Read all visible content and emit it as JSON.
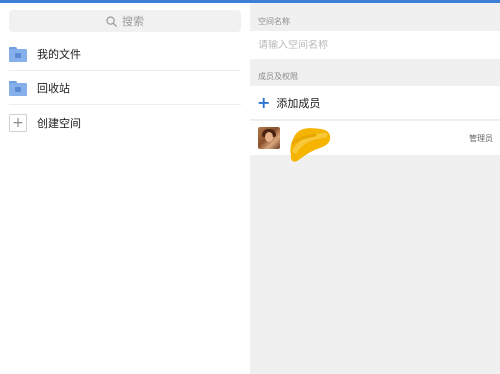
{
  "left": {
    "search": {
      "placeholder": "搜索"
    },
    "items": [
      {
        "label": "我的文件",
        "icon": "folder-icon"
      },
      {
        "label": "回收站",
        "icon": "folder-icon"
      },
      {
        "label": "创建空间",
        "icon": "plus-icon"
      }
    ]
  },
  "right": {
    "space_name_label": "空间名称",
    "space_name_placeholder": "请输入空间名称",
    "members_label": "成员及权限",
    "add_member_label": "添加成员",
    "members": [
      {
        "role": "管理员"
      }
    ]
  },
  "colors": {
    "accent": "#3d7fd6",
    "add_plus": "#2e74d4",
    "redaction": "#f5b400"
  }
}
